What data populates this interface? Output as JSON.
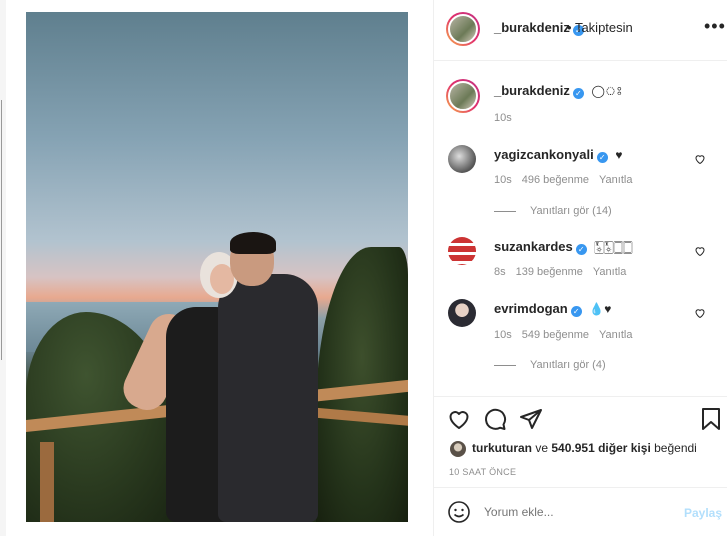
{
  "header": {
    "username": "_burakdeniz",
    "separator": "•",
    "follow_status": "Takiptesin",
    "more_label": "•••"
  },
  "caption": {
    "username": "_burakdeniz",
    "text": "◯ঃ",
    "time": "10s"
  },
  "comments": [
    {
      "username": "yagizcankonyali",
      "text": "♥",
      "time": "10s",
      "likes": "496 beğenme",
      "reply": "Yanıtla",
      "view_replies": "Yanıtları gör (14)"
    },
    {
      "username": "suzankardes",
      "text": "🀧🀧🀆🀆",
      "time": "8s",
      "likes": "139 beğenme",
      "reply": "Yanıtla",
      "view_replies": ""
    },
    {
      "username": "evrimdogan",
      "text": "💧♥",
      "time": "10s",
      "likes": "549 beğenme",
      "reply": "Yanıtla",
      "view_replies": "Yanıtları gör (4)"
    }
  ],
  "likes": {
    "user": "turkuturan",
    "connector": "ve",
    "rest": "540.951 diğer kişi",
    "verb": "beğendi"
  },
  "time_ago": "10 SAAT ÖNCE",
  "comment_box": {
    "placeholder": "Yorum ekle...",
    "post_label": "Paylaş"
  },
  "colors": {
    "verified": "#3897f0",
    "post_disabled": "#b2dffc",
    "muted": "#8e8e8e"
  }
}
